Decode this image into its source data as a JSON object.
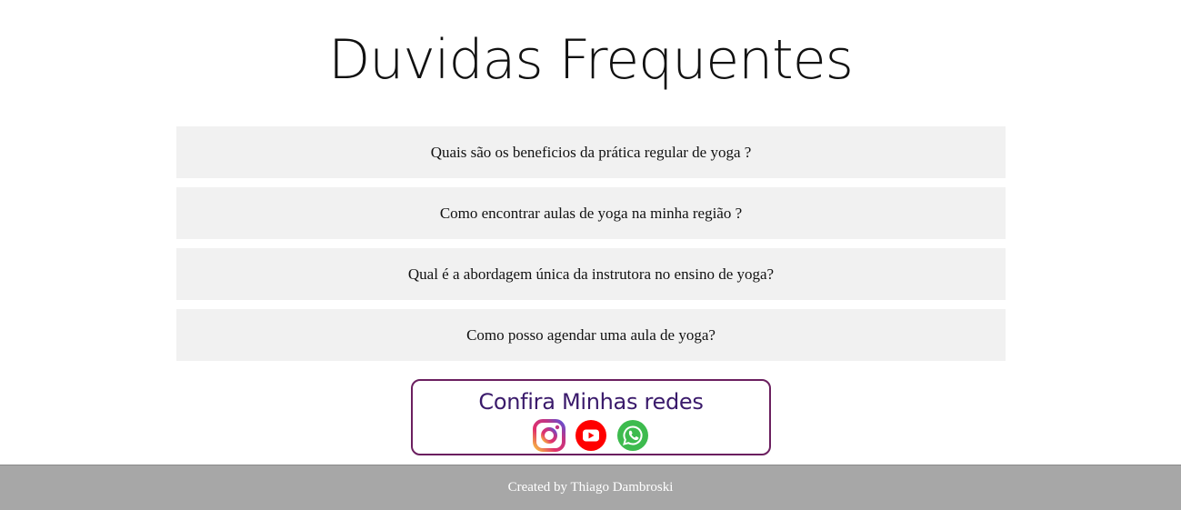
{
  "page": {
    "title": "Duvidas Frequentes"
  },
  "faq": {
    "items": [
      {
        "question": "Quais são os beneficios da prática regular de yoga ?"
      },
      {
        "question": "Como encontrar aulas de yoga na minha região ?"
      },
      {
        "question": "Qual é a abordagem única da instrutora no ensino de yoga?"
      },
      {
        "question": "Como posso agendar uma aula de yoga?"
      }
    ]
  },
  "social": {
    "title": "Confira Minhas redes",
    "icons": [
      "instagram-icon",
      "youtube-icon",
      "whatsapp-icon"
    ],
    "border_color": "#6b1f5f",
    "title_color": "#3a1a6b"
  },
  "footer": {
    "text": "Created by Thiago Dambroski",
    "background": "#a7a7a7"
  }
}
